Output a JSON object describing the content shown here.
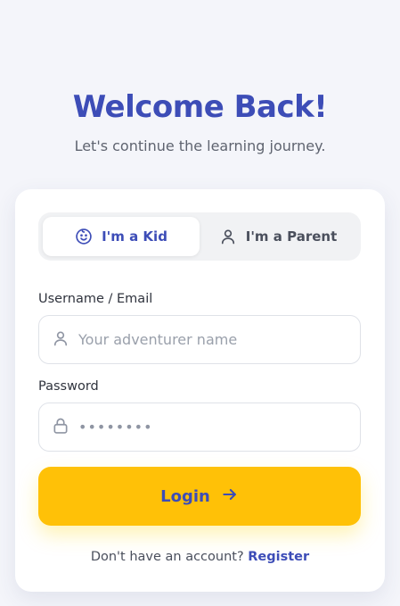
{
  "header": {
    "title": "Welcome Back!",
    "subtitle": "Let's continue the learning journey."
  },
  "role_toggle": {
    "kid_label": "I'm a Kid",
    "parent_label": "I'm a Parent",
    "selected": "kid"
  },
  "form": {
    "username_label": "Username / Email",
    "username_placeholder": "Your adventurer name",
    "username_value": "",
    "password_label": "Password",
    "password_mask": "••••••••"
  },
  "login": {
    "label": "Login"
  },
  "footer": {
    "prompt": "Don't have an account?",
    "register_label": "Register"
  },
  "colors": {
    "primary": "#3d4db7",
    "accent": "#ffc107",
    "background": "#f4f5fa",
    "card": "#ffffff"
  },
  "icons": {
    "kid": "smiley-face-icon",
    "parent": "user-icon",
    "username": "user-icon",
    "password": "lock-icon",
    "login": "arrow-right-icon"
  }
}
